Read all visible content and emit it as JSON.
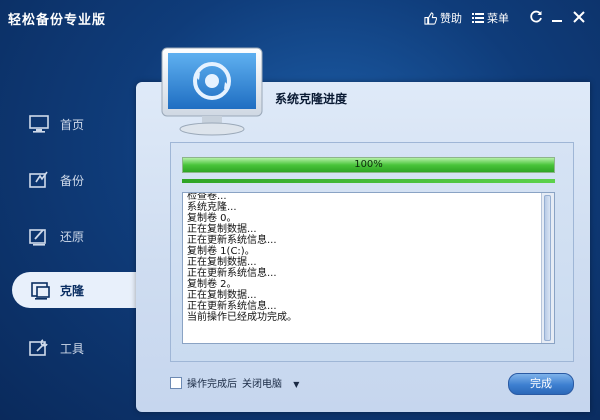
{
  "app": {
    "title": "轻松备份专业版"
  },
  "titlebar": {
    "like_label": "赞助",
    "menu_label": "菜单"
  },
  "sidebar": {
    "items": [
      {
        "label": "首页",
        "icon": "home-monitor-icon"
      },
      {
        "label": "备份",
        "icon": "backup-icon"
      },
      {
        "label": "还原",
        "icon": "restore-icon"
      },
      {
        "label": "克隆",
        "icon": "clone-icon",
        "active": true
      },
      {
        "label": "工具",
        "icon": "tools-icon"
      }
    ]
  },
  "panel": {
    "title": "系统克隆进度",
    "progress": {
      "value": 1.0,
      "label": "100%"
    },
    "log": [
      "检查卷...",
      "系统克隆...",
      "复制卷 0。",
      "正在复制数据...",
      "正在更新系统信息...",
      "复制卷 1(C:)。",
      "正在复制数据...",
      "正在更新系统信息...",
      "复制卷 2。",
      "正在复制数据...",
      "正在更新系统信息...",
      "当前操作已经成功完成。"
    ],
    "footer": {
      "checkbox_label": "操作完成后",
      "dropdown_value": "关闭电脑"
    },
    "done_label": "完成"
  },
  "colors": {
    "accent": "#3d7fd0",
    "progress": "#49c43a",
    "background": "#0f3c7a"
  }
}
